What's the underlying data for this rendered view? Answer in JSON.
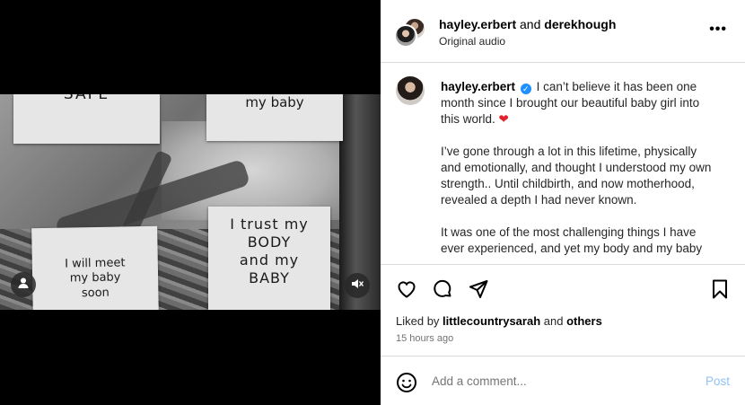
{
  "post": {
    "notes": {
      "note_a": "SAFE",
      "note_b": "my baby",
      "note_c": "I will meet\nmy baby\nsoon",
      "note_d": "I trust my\nBODY\nand my\nBABY"
    },
    "icons": {
      "user_tag": "person-icon",
      "mute": "speaker-muted-icon"
    }
  },
  "header": {
    "user1": "hayley.erbert",
    "joiner": " and ",
    "user2": "derekhough",
    "subtitle": "Original audio",
    "more": "•••"
  },
  "caption": {
    "username": "hayley.erbert",
    "verified": "✓",
    "line1": " I can’t believe it has been one month since I brought our beautiful baby girl into this world. ",
    "heart": "❤",
    "para2": "I’ve gone through a lot in this lifetime, physically and emotionally, and thought I understood my own strength.. Until childbirth, and now motherhood, revealed a depth I had never known.",
    "para3": "It was one of the most challenging things I have ever experienced, and yet my body and my baby"
  },
  "actions": {
    "like": "heart-icon",
    "comment": "comment-icon",
    "share": "send-icon",
    "save": "bookmark-icon"
  },
  "likes": {
    "prefix": "Liked by ",
    "user": "littlecountrysarah",
    "middle": " and ",
    "others": "others"
  },
  "timestamp": "15 hours ago",
  "comment": {
    "placeholder": "Add a comment...",
    "post_label": "Post"
  },
  "colors": {
    "verified": "#1e90ff",
    "post_disabled": "#8fc2f5",
    "heart": "#e0242e"
  }
}
